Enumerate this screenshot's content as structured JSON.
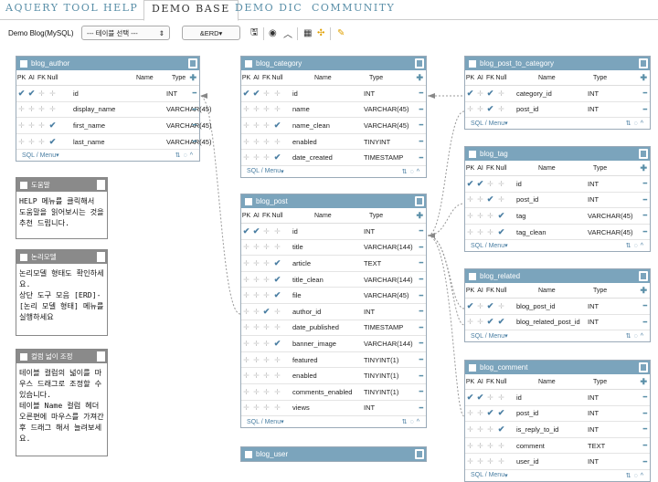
{
  "nav": {
    "items": [
      "AQUERY TOOL",
      "HELP",
      "DEMO BASE",
      "DEMO DIC",
      "COMMUNITY"
    ],
    "active": "DEMO BASE"
  },
  "toolbar": {
    "db_label": "Demo Blog(MySQL)",
    "table_select": "--- 테이블 선택 ---",
    "erd_label": "ERD",
    "icons": [
      "save-icon",
      "eye-icon",
      "collapse-icon",
      "grid-icon",
      "move-icon",
      "pin-icon"
    ]
  },
  "col_headers": {
    "pk": "PK",
    "ai": "AI",
    "fk": "FK",
    "null": "Null",
    "name": "Name",
    "type": "Type"
  },
  "footer_label": "SQL / Menu",
  "tables": {
    "blog_author": {
      "title": "blog_author",
      "rows": [
        {
          "pk": true,
          "ai": true,
          "fk": false,
          "nn": false,
          "name": "id",
          "type": "INT"
        },
        {
          "pk": false,
          "ai": false,
          "fk": false,
          "nn": false,
          "name": "display_name",
          "type": "VARCHAR(45)"
        },
        {
          "pk": false,
          "ai": false,
          "fk": false,
          "nn": true,
          "name": "first_name",
          "type": "VARCHAR(45)"
        },
        {
          "pk": false,
          "ai": false,
          "fk": false,
          "nn": true,
          "name": "last_name",
          "type": "VARCHAR(45)"
        }
      ]
    },
    "blog_category": {
      "title": "blog_category",
      "rows": [
        {
          "pk": true,
          "ai": true,
          "fk": false,
          "nn": false,
          "name": "id",
          "type": "INT"
        },
        {
          "pk": false,
          "ai": false,
          "fk": false,
          "nn": false,
          "name": "name",
          "type": "VARCHAR(45)"
        },
        {
          "pk": false,
          "ai": false,
          "fk": false,
          "nn": true,
          "name": "name_clean",
          "type": "VARCHAR(45)"
        },
        {
          "pk": false,
          "ai": false,
          "fk": false,
          "nn": false,
          "name": "enabled",
          "type": "TINYINT"
        },
        {
          "pk": false,
          "ai": false,
          "fk": false,
          "nn": true,
          "name": "date_created",
          "type": "TIMESTAMP"
        }
      ]
    },
    "blog_post": {
      "title": "blog_post",
      "rows": [
        {
          "pk": true,
          "ai": true,
          "fk": false,
          "nn": false,
          "name": "id",
          "type": "INT"
        },
        {
          "pk": false,
          "ai": false,
          "fk": false,
          "nn": false,
          "name": "title",
          "type": "VARCHAR(144)"
        },
        {
          "pk": false,
          "ai": false,
          "fk": false,
          "nn": true,
          "name": "article",
          "type": "TEXT"
        },
        {
          "pk": false,
          "ai": false,
          "fk": false,
          "nn": true,
          "name": "title_clean",
          "type": "VARCHAR(144)"
        },
        {
          "pk": false,
          "ai": false,
          "fk": false,
          "nn": true,
          "name": "file",
          "type": "VARCHAR(45)"
        },
        {
          "pk": false,
          "ai": false,
          "fk": true,
          "nn": false,
          "name": "author_id",
          "type": "INT"
        },
        {
          "pk": false,
          "ai": false,
          "fk": false,
          "nn": false,
          "name": "date_published",
          "type": "TIMESTAMP"
        },
        {
          "pk": false,
          "ai": false,
          "fk": false,
          "nn": true,
          "name": "banner_image",
          "type": "VARCHAR(144)"
        },
        {
          "pk": false,
          "ai": false,
          "fk": false,
          "nn": false,
          "name": "featured",
          "type": "TINYINT(1)"
        },
        {
          "pk": false,
          "ai": false,
          "fk": false,
          "nn": false,
          "name": "enabled",
          "type": "TINYINT(1)"
        },
        {
          "pk": false,
          "ai": false,
          "fk": false,
          "nn": false,
          "name": "comments_enabled",
          "type": "TINYINT(1)"
        },
        {
          "pk": false,
          "ai": false,
          "fk": false,
          "nn": false,
          "name": "views",
          "type": "INT"
        }
      ]
    },
    "blog_user": {
      "title": "blog_user",
      "rows": []
    },
    "blog_post_to_category": {
      "title": "blog_post_to_category",
      "rows": [
        {
          "pk": true,
          "ai": false,
          "fk": true,
          "nn": false,
          "name": "category_id",
          "type": "INT"
        },
        {
          "pk": false,
          "ai": false,
          "fk": true,
          "nn": false,
          "name": "post_id",
          "type": "INT"
        }
      ]
    },
    "blog_tag": {
      "title": "blog_tag",
      "rows": [
        {
          "pk": true,
          "ai": true,
          "fk": false,
          "nn": false,
          "name": "id",
          "type": "INT"
        },
        {
          "pk": false,
          "ai": false,
          "fk": true,
          "nn": false,
          "name": "post_id",
          "type": "INT"
        },
        {
          "pk": false,
          "ai": false,
          "fk": false,
          "nn": true,
          "name": "tag",
          "type": "VARCHAR(45)"
        },
        {
          "pk": false,
          "ai": false,
          "fk": false,
          "nn": true,
          "name": "tag_clean",
          "type": "VARCHAR(45)"
        }
      ]
    },
    "blog_related": {
      "title": "blog_related",
      "rows": [
        {
          "pk": true,
          "ai": false,
          "fk": true,
          "nn": false,
          "name": "blog_post_id",
          "type": "INT"
        },
        {
          "pk": false,
          "ai": false,
          "fk": true,
          "nn": true,
          "name": "blog_related_post_id",
          "type": "INT"
        }
      ]
    },
    "blog_comment": {
      "title": "blog_comment",
      "rows": [
        {
          "pk": true,
          "ai": true,
          "fk": false,
          "nn": false,
          "name": "id",
          "type": "INT"
        },
        {
          "pk": false,
          "ai": false,
          "fk": true,
          "nn": true,
          "name": "post_id",
          "type": "INT"
        },
        {
          "pk": false,
          "ai": false,
          "fk": false,
          "nn": true,
          "name": "is_reply_to_id",
          "type": "INT"
        },
        {
          "pk": false,
          "ai": false,
          "fk": false,
          "nn": false,
          "name": "comment",
          "type": "TEXT"
        },
        {
          "pk": false,
          "ai": false,
          "fk": false,
          "nn": false,
          "name": "user_id",
          "type": "INT"
        }
      ]
    }
  },
  "notes": [
    {
      "title": "도움말",
      "body": "HELP 메뉴를 클릭해서\n도움말을 읽어보시는 것을\n추천 드립니다."
    },
    {
      "title": "논리모델",
      "body": "논리모델 형태도 확인하세\n요.\n상단 도구 모음 [ERD]-\n[논리 모델 형태] 메뉴를\n실행하세요"
    },
    {
      "title": "컬럼 넓이 조정",
      "body": "테이블 컬럼의 넓이를 마\n우스 드래그로 조정할 수\n있습니다.\n테이블 Name 컬럼 헤더\n오른편에 마우스를 가져간\n후 드래그 해서 늘려보세\n요."
    }
  ],
  "colors": {
    "table_header": "#7ba4bc",
    "note_header": "#8a8a8a",
    "nav_link": "#5a8fa8",
    "check": "#4b7fa3"
  }
}
